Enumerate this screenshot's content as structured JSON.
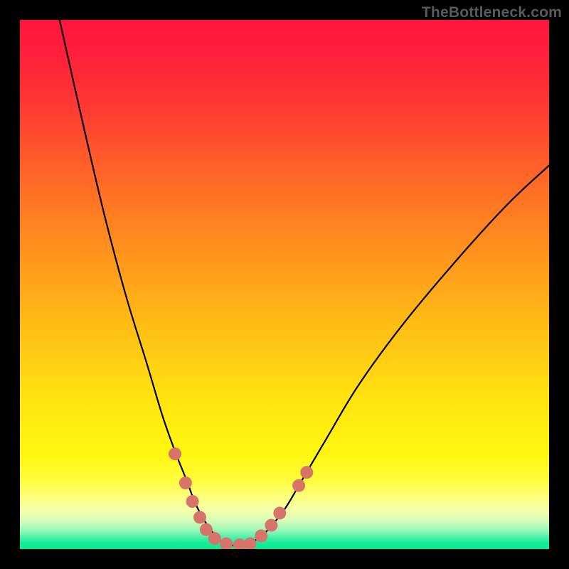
{
  "watermark": "TheBottleneck.com",
  "colors": {
    "frame": "#000000",
    "curve_stroke": "#000000",
    "marker_fill": "#d77469",
    "gradient_top": "#ff163f",
    "gradient_bottom": "#0dec90"
  },
  "chart_data": {
    "type": "line",
    "title": "",
    "xlabel": "",
    "ylabel": "",
    "xlim": [
      0,
      100
    ],
    "ylim": [
      0,
      100
    ],
    "note": "x and y are normalized percentages of the plot area; origin at top-left (y increases downward). No axis ticks or labels visible.",
    "series": [
      {
        "name": "bottleneck-curve",
        "x": [
          7.5,
          12,
          16,
          20,
          24,
          27,
          29.5,
          31.5,
          33,
          34.5,
          35.8,
          37,
          38,
          39,
          40,
          41.5,
          43,
          45,
          47,
          50,
          53,
          58,
          64,
          72,
          82,
          92,
          100
        ],
        "y": [
          0,
          20,
          37,
          52,
          65,
          75,
          82,
          87,
          91,
          94,
          96,
          97.5,
          98.5,
          99,
          99.3,
          99.3,
          99,
          98,
          96.2,
          92.5,
          87.5,
          79,
          69,
          58,
          46,
          35,
          27.5
        ]
      }
    ],
    "markers": {
      "name": "highlight-dots",
      "color": "#d77469",
      "points": [
        {
          "x": 29.3,
          "y": 82
        },
        {
          "x": 31.3,
          "y": 87.5
        },
        {
          "x": 32.6,
          "y": 91
        },
        {
          "x": 34.0,
          "y": 94
        },
        {
          "x": 35.2,
          "y": 96.3
        },
        {
          "x": 36.8,
          "y": 98
        },
        {
          "x": 39.0,
          "y": 99
        },
        {
          "x": 41.5,
          "y": 99.2
        },
        {
          "x": 43.5,
          "y": 99
        },
        {
          "x": 45.6,
          "y": 97.5
        },
        {
          "x": 47.5,
          "y": 95.5
        },
        {
          "x": 49.1,
          "y": 93.2
        },
        {
          "x": 52.7,
          "y": 88
        },
        {
          "x": 54.2,
          "y": 85.5
        }
      ]
    }
  }
}
